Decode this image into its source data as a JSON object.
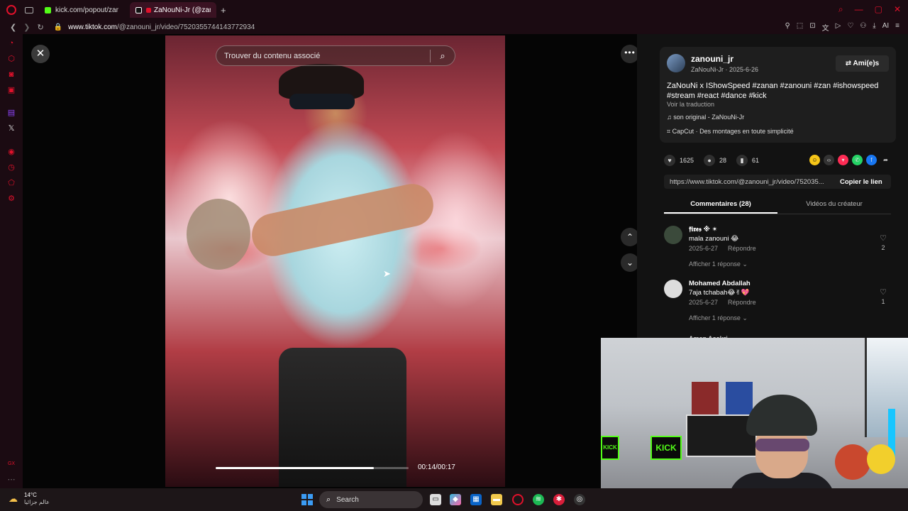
{
  "browser": {
    "tabs": [
      {
        "label": "kick.com/popout/zanouni/",
        "color": "#53fc18"
      },
      {
        "label": "ZaNouNi-Jr (@zanouni",
        "color": "#ffffff"
      }
    ],
    "new_tab": "+",
    "url_host": "www.tiktok.com",
    "url_path": "/@zanouni_jr/video/7520355744143772934"
  },
  "video": {
    "search_placeholder": "Trouver du contenu associé",
    "progress_fraction": 0.82,
    "time": "00:14/00:17"
  },
  "post": {
    "username": "zanouni_jr",
    "subline": "ZaNouNi-Jr · 2025-6-26",
    "friends_button": "Ami(e)s",
    "description": "ZaNouNi x IShowSpeed #zanan #zanouni #zan #ishowspeed #stream #react #dance #kick",
    "translate": "Voir la traduction",
    "sound": "son original - ZaNouNi-Jr",
    "capcut": "CapCut · Des montages en toute simplicité"
  },
  "actions": {
    "likes": "1625",
    "comments": "28",
    "saves": "61"
  },
  "share": {
    "link": "https://www.tiktok.com/@zanouni_jr/video/752035...",
    "copy_label": "Copier le lien"
  },
  "panel_tabs": {
    "comments": "Commentaires (28)",
    "creator_videos": "Vidéos du créateur"
  },
  "comments": [
    {
      "name": "𝖋𝖎𝖗𝖊𝖘 ※ ✴",
      "text": "mala zanouni 😂",
      "date": "2025-6-27",
      "reply": "Répondre",
      "replies": "Afficher 1 réponse ⌄",
      "likes": "2"
    },
    {
      "name": "Mohamed Abdallah",
      "text": "7aja tchabah😂✌💖",
      "date": "2025-6-27",
      "reply": "Répondre",
      "replies": "Afficher 1 réponse ⌄",
      "likes": "1"
    }
  ],
  "comment_partial": "Amen Asakri",
  "webcam": {
    "kick_sign": "KICK",
    "kick_small": "KICK"
  },
  "taskbar": {
    "temp": "14°C",
    "location": "عالم جزائيا",
    "search_label": "Search"
  }
}
